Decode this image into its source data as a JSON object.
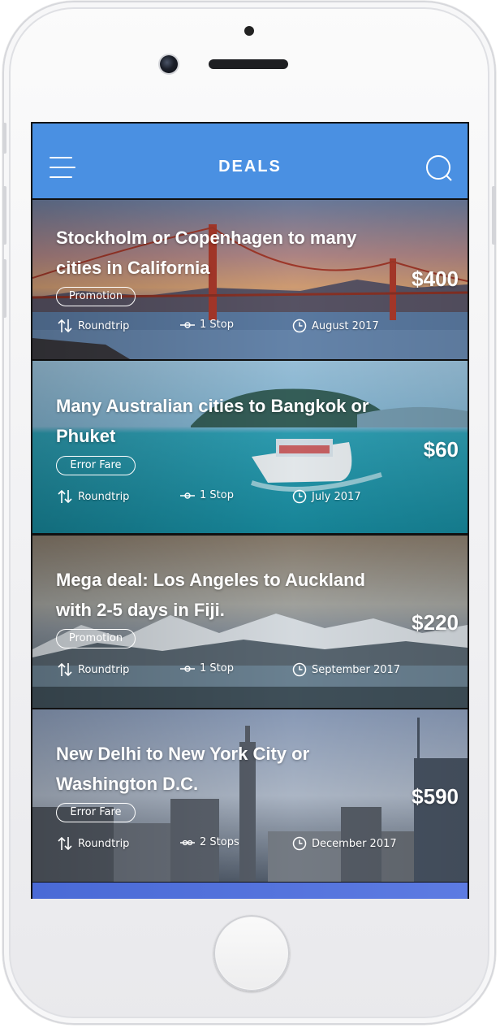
{
  "header": {
    "title": "DEALS",
    "menu_icon": "menu-icon",
    "search_icon": "search-icon"
  },
  "deals": [
    {
      "title": "Stockholm or Copenhagen to many cities in California",
      "badge": "Promotion",
      "price": "$400",
      "trip": "Roundtrip",
      "stops": "1 Stop",
      "date": "August 2017"
    },
    {
      "title": "Many Australian cities to Bangkok or Phuket",
      "badge": "Error Fare",
      "price": "$60",
      "trip": "Roundtrip",
      "stops": "1 Stop",
      "date": "July 2017"
    },
    {
      "title": "Mega deal: Los Angeles to Auckland with 2-5 days in Fiji.",
      "badge": "Promotion",
      "price": "$220",
      "trip": "Roundtrip",
      "stops": "1 Stop",
      "date": "September 2017"
    },
    {
      "title": "New Delhi to New York City or Washington D.C.",
      "badge": "Error Fare",
      "price": "$590",
      "trip": "Roundtrip",
      "stops": "2 Stops",
      "date": "December 2017"
    }
  ],
  "colors": {
    "accent": "#4a90e2",
    "text": "#ffffff"
  }
}
